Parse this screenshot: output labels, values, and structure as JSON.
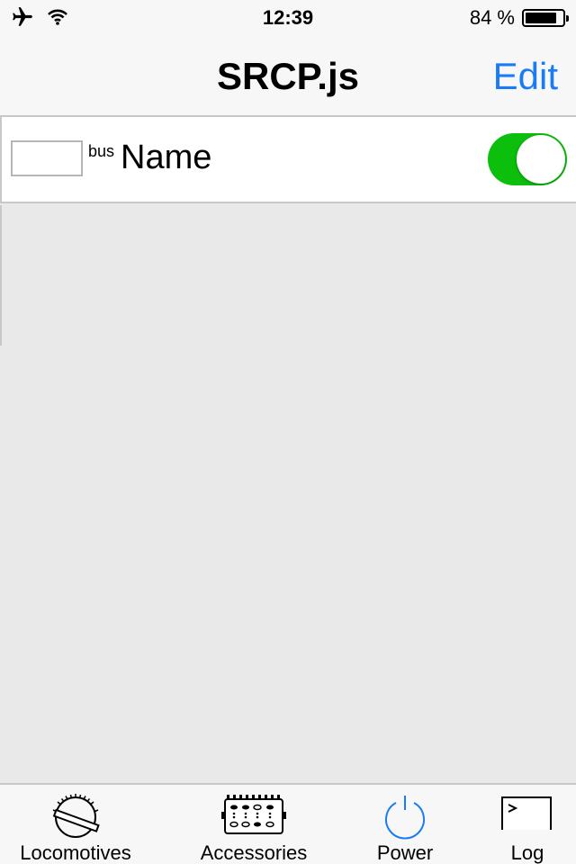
{
  "status_bar": {
    "time": "12:39",
    "battery_text": "84 %",
    "battery_level": 0.84,
    "airplane_icon": "airplane-icon",
    "wifi_icon": "wifi-icon"
  },
  "nav": {
    "title": "SRCP.js",
    "edit_label": "Edit"
  },
  "rows": [
    {
      "input_value": "",
      "bus_label": "bus",
      "name": "Name",
      "enabled": true
    }
  ],
  "tab_bar": {
    "tabs": [
      {
        "label": "Locomotives",
        "icon": "locomotive-dial-icon"
      },
      {
        "label": "Accessories",
        "icon": "accessories-panel-icon"
      },
      {
        "label": "Power",
        "icon": "power-icon"
      },
      {
        "label": "Log",
        "icon": "terminal-icon"
      }
    ]
  },
  "colors": {
    "accent": "#1a7cf5",
    "toggle_on": "#0cbf0c",
    "background": "#e9e9e9",
    "bar_background": "#f7f7f7",
    "separator": "#c8c7cc"
  }
}
